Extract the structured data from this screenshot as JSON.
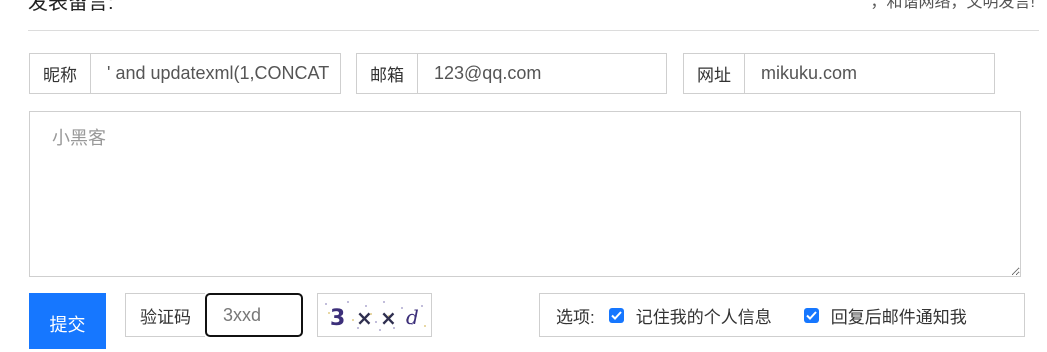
{
  "header": {
    "title": "发表留言:",
    "note": "，和谐网络，文明发言!"
  },
  "form": {
    "nickname": {
      "label": "昵称",
      "value": "' and updatexml(1,CONCAT"
    },
    "email": {
      "label": "邮箱",
      "value": "123@qq.com"
    },
    "website": {
      "label": "网址",
      "value": "mikuku.com"
    },
    "message": {
      "placeholder": "小黑客"
    },
    "submit_label": "提交",
    "captcha": {
      "label": "验证码",
      "value": "3xxd",
      "image_text": "3xxd"
    },
    "options": {
      "title": "选项:",
      "items": [
        {
          "label": "记住我的个人信息",
          "checked": true
        },
        {
          "label": "回复后邮件通知我",
          "checked": true
        }
      ]
    }
  },
  "colors": {
    "accent": "#1677ff",
    "border": "#cfcfcf"
  }
}
